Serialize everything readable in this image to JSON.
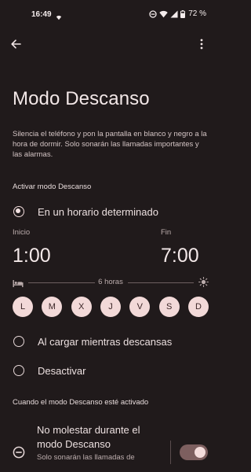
{
  "status_bar": {
    "time": "16:49",
    "battery": "72 %"
  },
  "page": {
    "title": "Modo Descanso",
    "description": "Silencia el teléfono y pon la pantalla en blanco y negro a la hora de dormir. Solo sonarán las llamadas importantes y las alarmas."
  },
  "activation": {
    "header": "Activar modo Descanso",
    "options": [
      {
        "label": "En un horario determinado",
        "selected": true
      },
      {
        "label": "Al cargar mientras descansas",
        "selected": false
      },
      {
        "label": "Desactivar",
        "selected": false
      }
    ]
  },
  "schedule": {
    "start_caption": "Inicio",
    "start_time": "1:00",
    "end_caption": "Fin",
    "end_time": "7:00",
    "duration": "6 horas",
    "days": [
      "L",
      "M",
      "X",
      "J",
      "V",
      "S",
      "D"
    ]
  },
  "when_active": {
    "header": "Cuando el modo Descanso esté activado",
    "dnd_title": "No molestar durante el modo Descanso",
    "dnd_subtitle": "Solo sonarán las llamadas de",
    "dnd_enabled": true
  },
  "colors": {
    "background": "#201a1b",
    "accent": "#f2d9d8",
    "toggle_track": "#7d5f5f"
  }
}
